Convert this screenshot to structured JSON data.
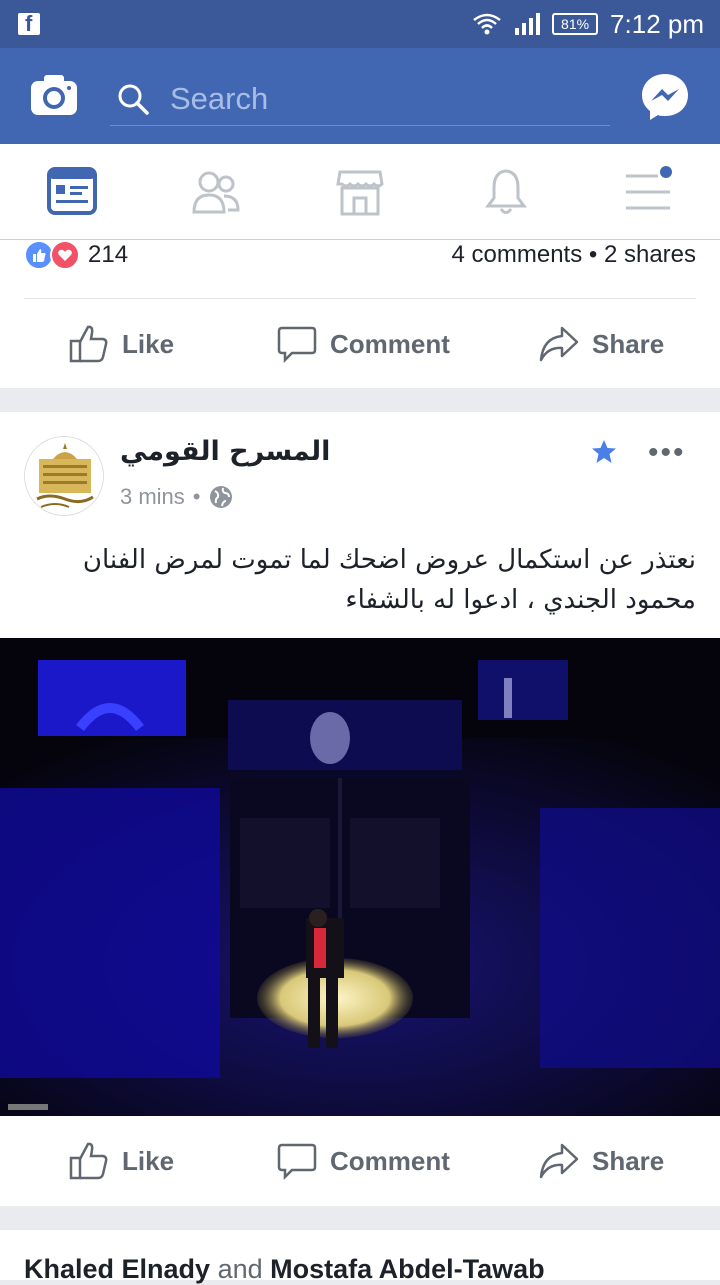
{
  "status_bar": {
    "app_icon": "facebook-icon",
    "battery": "81%",
    "time": "7:12 pm",
    "icons": [
      "wifi-icon",
      "signal-icon",
      "battery-icon"
    ]
  },
  "topbar": {
    "search_placeholder": "Search",
    "icons": [
      "camera-icon",
      "search-icon",
      "messenger-icon"
    ],
    "color": "#4267b2"
  },
  "navbar": {
    "items": [
      "news-feed-icon",
      "friends-icon",
      "marketplace-icon",
      "notifications-icon",
      "menu-icon"
    ],
    "active_color": "#4267b2"
  },
  "post1_footer": {
    "reaction_count": "214",
    "comments_shares": "4 comments • 2 shares",
    "actions": {
      "like": "Like",
      "comment": "Comment",
      "share": "Share"
    }
  },
  "post2": {
    "page_name": "المسرح القومي",
    "time": "3 mins",
    "separator": "•",
    "text_line1": "نعتذر عن استكمال عروض اضحك لما تموت لمرض الفنان",
    "text_line2": "محمود الجندي ، ادعوا له بالشفاء",
    "actions": {
      "like": "Like",
      "comment": "Comment",
      "share": "Share"
    }
  },
  "post3": {
    "name1": "Khaled Elnady",
    "connector": "and",
    "name2": "Mostafa Abdel-Tawab"
  }
}
